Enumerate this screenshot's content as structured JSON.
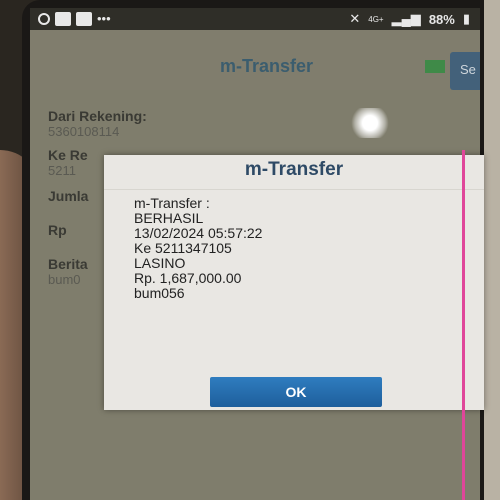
{
  "statusbar": {
    "signal": "4G+",
    "battery": "88%"
  },
  "app": {
    "title": "m-Transfer",
    "send_label": "Se"
  },
  "form": {
    "from_label": "Dari Rekening:",
    "from_value": "5360108114",
    "to_label": "Ke Re",
    "to_value": "5211",
    "amount_label": "Jumla",
    "currency_label": "Rp",
    "message_label": "Berita",
    "message_value": "bum0"
  },
  "dialog": {
    "title": "m-Transfer",
    "lines": [
      "m-Transfer :",
      "BERHASIL",
      "13/02/2024 05:57:22",
      "Ke 5211347105",
      "LASINO",
      "Rp. 1,687,000.00",
      "bum056"
    ],
    "ok_label": "OK"
  },
  "colors": {
    "dialog_title": "#2e4a66",
    "ok_button": "#2f7dbf",
    "screen_overlay": "#7f7d6c"
  }
}
